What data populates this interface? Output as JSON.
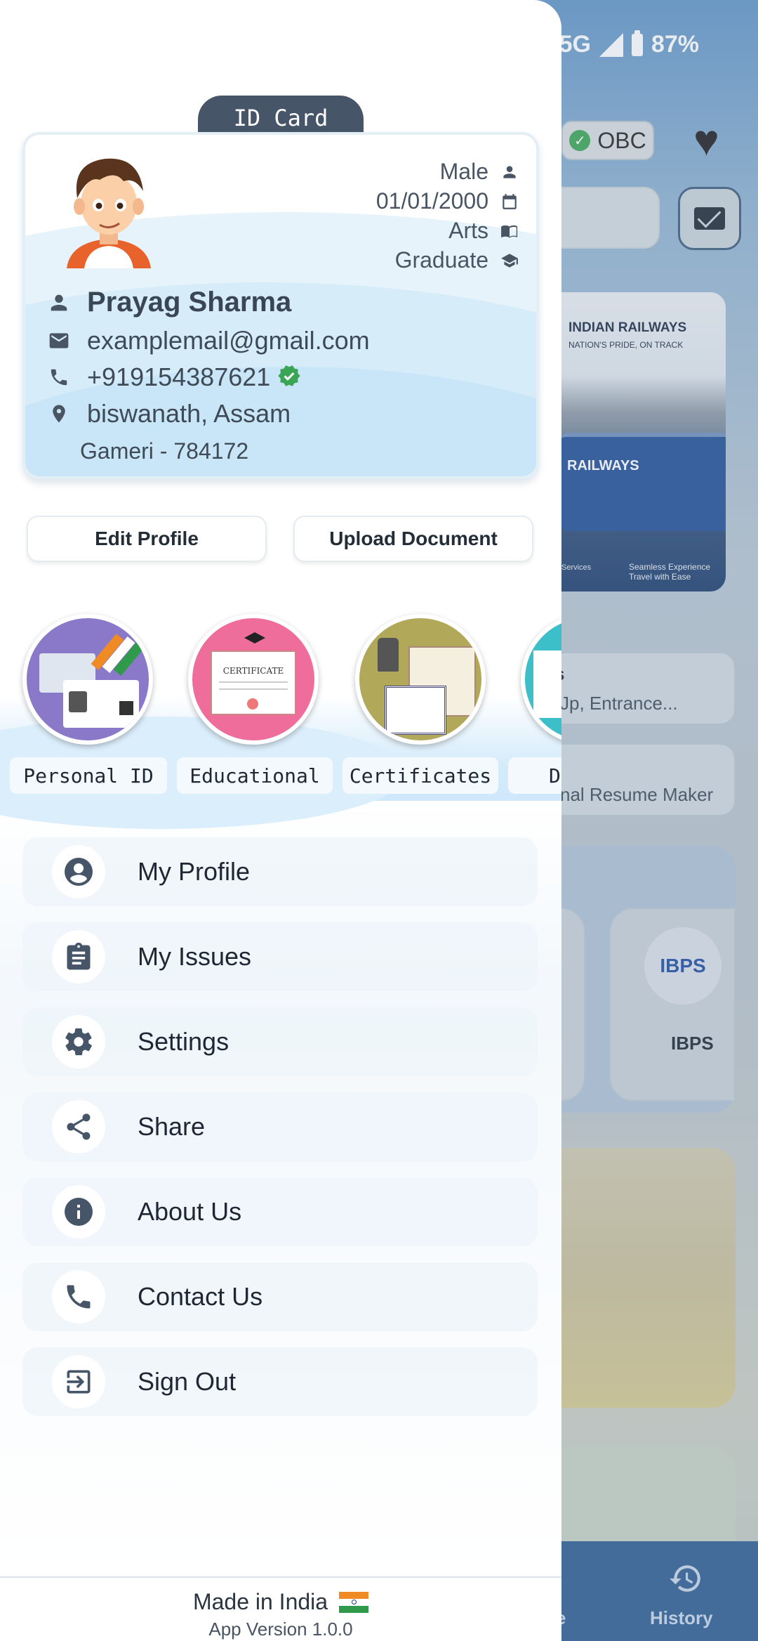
{
  "status_bar": {
    "network": "5G",
    "battery": "87%"
  },
  "background_app": {
    "caste_badge": "OBC",
    "banner": {
      "title": "INDIAN RAILWAYS",
      "subtitle": "NATION'S PRIDE, ON TRACK",
      "train_text": "RAILWAYS",
      "footer_left": "Services",
      "footer_title": "Seamless Experience",
      "footer_sub": "Travel with Ease"
    },
    "card1_title": "s",
    "card1_sub": "Jp, Entrance...",
    "card2_sub": "nal Resume Maker",
    "exam_tile": "IBPS",
    "ibps_logo_text": "IBPS",
    "nav_partial": "de",
    "nav_history": "History"
  },
  "drawer": {
    "id_card_tab": "ID Card",
    "profile": {
      "gender": "Male",
      "dob": "01/01/2000",
      "stream": "Arts",
      "qualification": "Graduate",
      "name": "Prayag Sharma",
      "email": "examplemail@gmail.com",
      "phone": "+919154387621",
      "location": "biswanath, Assam",
      "pin": "Gameri - 784172"
    },
    "buttons": {
      "edit_profile": "Edit  Profile",
      "upload_document": "Upload  Document"
    },
    "categories": [
      {
        "label": "Personal ID"
      },
      {
        "label": "Educational"
      },
      {
        "label": "Certificates"
      },
      {
        "label": "D"
      }
    ],
    "menu": [
      {
        "label": "My Profile",
        "icon": "account-circle-icon"
      },
      {
        "label": "My Issues",
        "icon": "clipboard-icon"
      },
      {
        "label": "Settings",
        "icon": "gear-icon"
      },
      {
        "label": "Share",
        "icon": "share-icon"
      },
      {
        "label": "About Us",
        "icon": "info-icon"
      },
      {
        "label": "Contact Us",
        "icon": "phone-icon"
      },
      {
        "label": "Sign Out",
        "icon": "logout-icon"
      }
    ],
    "footer": {
      "made_in": "Made in India",
      "version": "App Version 1.0.0"
    }
  },
  "colors": {
    "accent": "#475569",
    "verified": "#3aa655",
    "nav": "#2d5d94"
  }
}
